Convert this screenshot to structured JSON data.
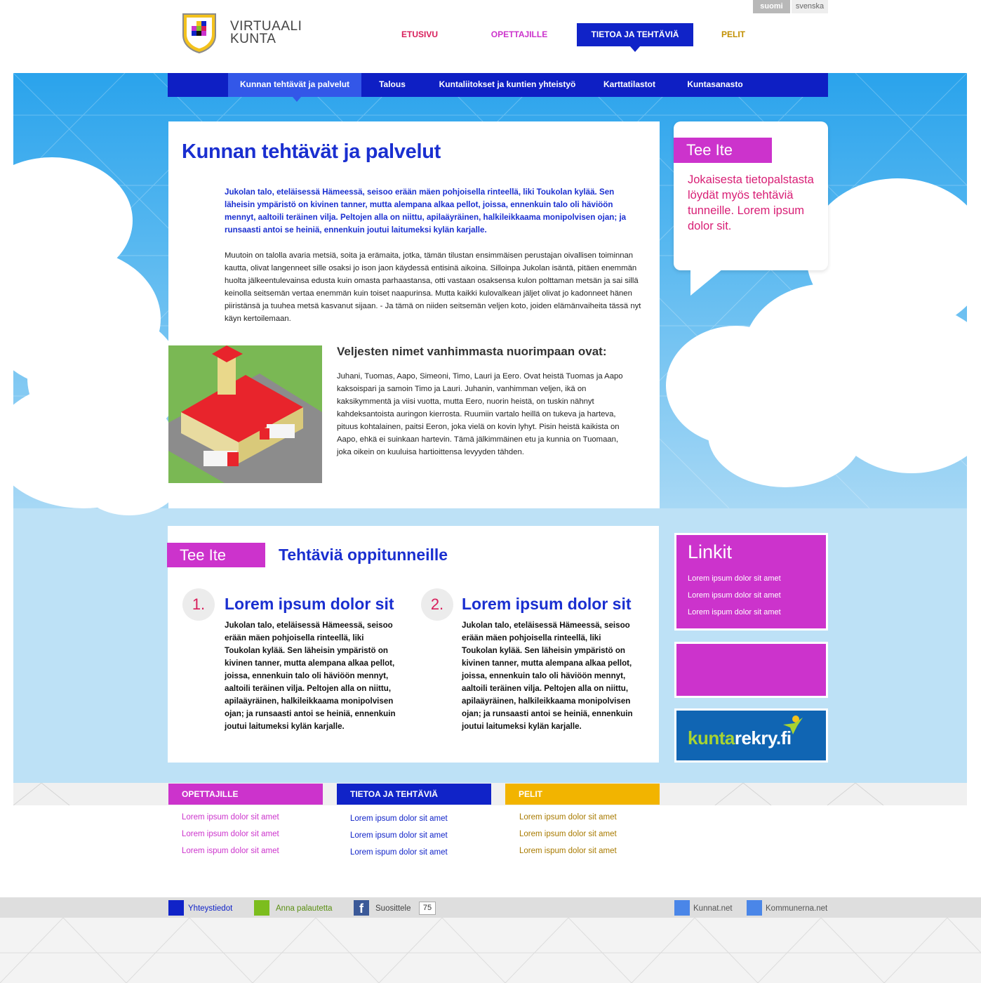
{
  "languages": {
    "active": "suomi",
    "other": "svenska"
  },
  "logo": {
    "line1": "VIRTUAALI",
    "line2": "KUNTA",
    "icon": "shield-logo-icon"
  },
  "top_nav": [
    {
      "label": "ETUSIVU",
      "color": "#d81e5b"
    },
    {
      "label": "OPETTAJILLE",
      "color": "#cc33cc"
    },
    {
      "label": "TIETOA JA TEHTÄVIÄ",
      "color": "#1023c8",
      "active": true
    },
    {
      "label": "PELIT",
      "color": "#c28f00"
    }
  ],
  "sub_nav": [
    {
      "label": "Kunnan tehtävät ja palvelut",
      "active": true
    },
    {
      "label": "Talous"
    },
    {
      "label": "Kuntaliitokset ja kuntien yhteistyö"
    },
    {
      "label": "Karttatilastot"
    },
    {
      "label": "Kuntasanasto"
    }
  ],
  "main": {
    "title": "Kunnan tehtävät ja palvelut",
    "lead": "Jukolan talo, eteläisessä Hämeessä, seisoo erään mäen pohjoisella rinteellä, liki Toukolan kylää. Sen läheisin ympäristö on kivinen tanner, mutta alempana alkaa pellot, joissa, ennenkuin talo oli häviöön mennyt, aaltoili teräinen vilja. Peltojen alla on niittu, apilaäyräinen, halkileikkaama monipolvisen ojan; ja runsaasti antoi se heiniä, ennenkuin joutui laitumeksi kylän karjalle.",
    "body": "Muutoin on talolla avaria metsiä, soita ja erämaita, jotka, tämän tilustan ensimmäisen perustajan oivallisen toiminnan kautta, olivat langenneet sille osaksi jo ison jaon käydessä entisinä aikoina. Silloinpa Jukolan isäntä, pitäen enemmän huolta jälkeentulevainsa edusta kuin omasta parhaastansa, otti vastaan osaksensa kulon polttaman metsän ja sai sillä keinolla seitsemän vertaa enemmän kuin toiset naapurinsa. Mutta kaikki kulovalkean jäljet olivat jo kadonneet hänen piiristänsä ja tuuhea metsä kasvanut sijaan. - Ja tämä on niiden seitsemän veljen koto, joiden elämänvaiheita tässä nyt käyn kertoilemaan.",
    "subheading": "Veljesten nimet vanhimmasta nuorimpaan ovat:",
    "body2": "Juhani, Tuomas, Aapo, Simeoni, Timo, Lauri ja Eero. Ovat heistä Tuomas ja Aapo kaksoispari ja samoin Timo ja Lauri. Juhanin, vanhimman veljen, ikä on kaksikymmentä ja viisi vuotta, mutta Eero, nuorin heistä, on tuskin nähnyt kahdeksantoista auringon kierrosta. Ruumiin vartalo heillä on tukeva ja harteva, pituus kohtalainen, paitsi Eeron, joka vielä on kovin lyhyt. Pisin heistä kaikista on Aapo, ehkä ei suinkaan hartevin. Tämä jälkimmäinen etu ja kunnia on Tuomaan, joka oikein on kuuluisa hartioittensa levyyden tähden."
  },
  "bubble": {
    "tag": "Tee Ite",
    "text": "Jokaisesta tietopalstasta löydät myös tehtäviä tunneille. Lorem ipsum dolor sit."
  },
  "tasks": {
    "tag": "Tee Ite",
    "title": "Tehtäviä oppitunneille",
    "items": [
      {
        "number": "1.",
        "title": "Lorem ipsum dolor sit",
        "body": "Jukolan talo, eteläisessä Hämeessä, seisoo erään mäen pohjoisella rinteellä, liki Toukolan kylää. Sen läheisin ympäristö on kivinen tanner, mutta alempana alkaa pellot, joissa, ennenkuin talo oli häviöön mennyt, aaltoili teräinen vilja. Peltojen alla on niittu, apilaäyräinen, halkileikkaama monipolvisen ojan; ja runsaasti antoi se heiniä, ennenkuin joutui laitumeksi kylän karjalle."
      },
      {
        "number": "2.",
        "title": "Lorem ipsum dolor sit",
        "body": "Jukolan talo, eteläisessä Hämeessä, seisoo erään mäen pohjoisella rinteellä, liki Toukolan kylää. Sen läheisin ympäristö on kivinen tanner, mutta alempana alkaa pellot, joissa, ennenkuin talo oli häviöön mennyt, aaltoili teräinen vilja. Peltojen alla on niittu, apilaäyräinen, halkileikkaama monipolvisen ojan; ja runsaasti antoi se heiniä, ennenkuin joutui laitumeksi kylän karjalle."
      }
    ]
  },
  "linkit": {
    "title": "Linkit",
    "links": [
      "Lorem ipsum dolor sit amet",
      "Lorem ipsum dolor sit amet",
      "Lorem ispum dolor sit amet"
    ]
  },
  "kuntarekry": {
    "part1": "kunta",
    "part2": "rekry",
    "part3": ".fi"
  },
  "footer_columns": [
    {
      "title": "OPETTAJILLE",
      "color": "#cc33cc",
      "links": [
        "Lorem ipsum dolor sit amet",
        "Lorem ipsum dolor sit amet",
        "Lorem ispum dolor sit amet"
      ]
    },
    {
      "title": "TIETOA JA TEHTÄVIÄ",
      "color": "#1023c8",
      "links": [
        "Lorem ipsum dolor sit amet",
        "Lorem ipsum dolor sit amet",
        "Lorem ispum dolor sit amet"
      ]
    },
    {
      "title": "PELIT",
      "color": "#f2b400",
      "link_color": "#a87a00",
      "links": [
        "Lorem ipsum dolor sit amet",
        "Lorem ipsum dolor sit amet",
        "Lorem ispum dolor sit amet"
      ]
    }
  ],
  "bottom_bar": {
    "contact": "Yhteystiedot",
    "feedback": "Anna palautetta",
    "recommend": "Suosittele",
    "recommend_count": "75",
    "site1": "Kunnat.net",
    "site2": "Kommunerna.net"
  },
  "colors": {
    "brand_blue": "#1023c8",
    "magenta": "#cc33cc",
    "pink_red": "#d81e5b",
    "gold": "#c28f00",
    "sky": "#2aa3ec"
  }
}
